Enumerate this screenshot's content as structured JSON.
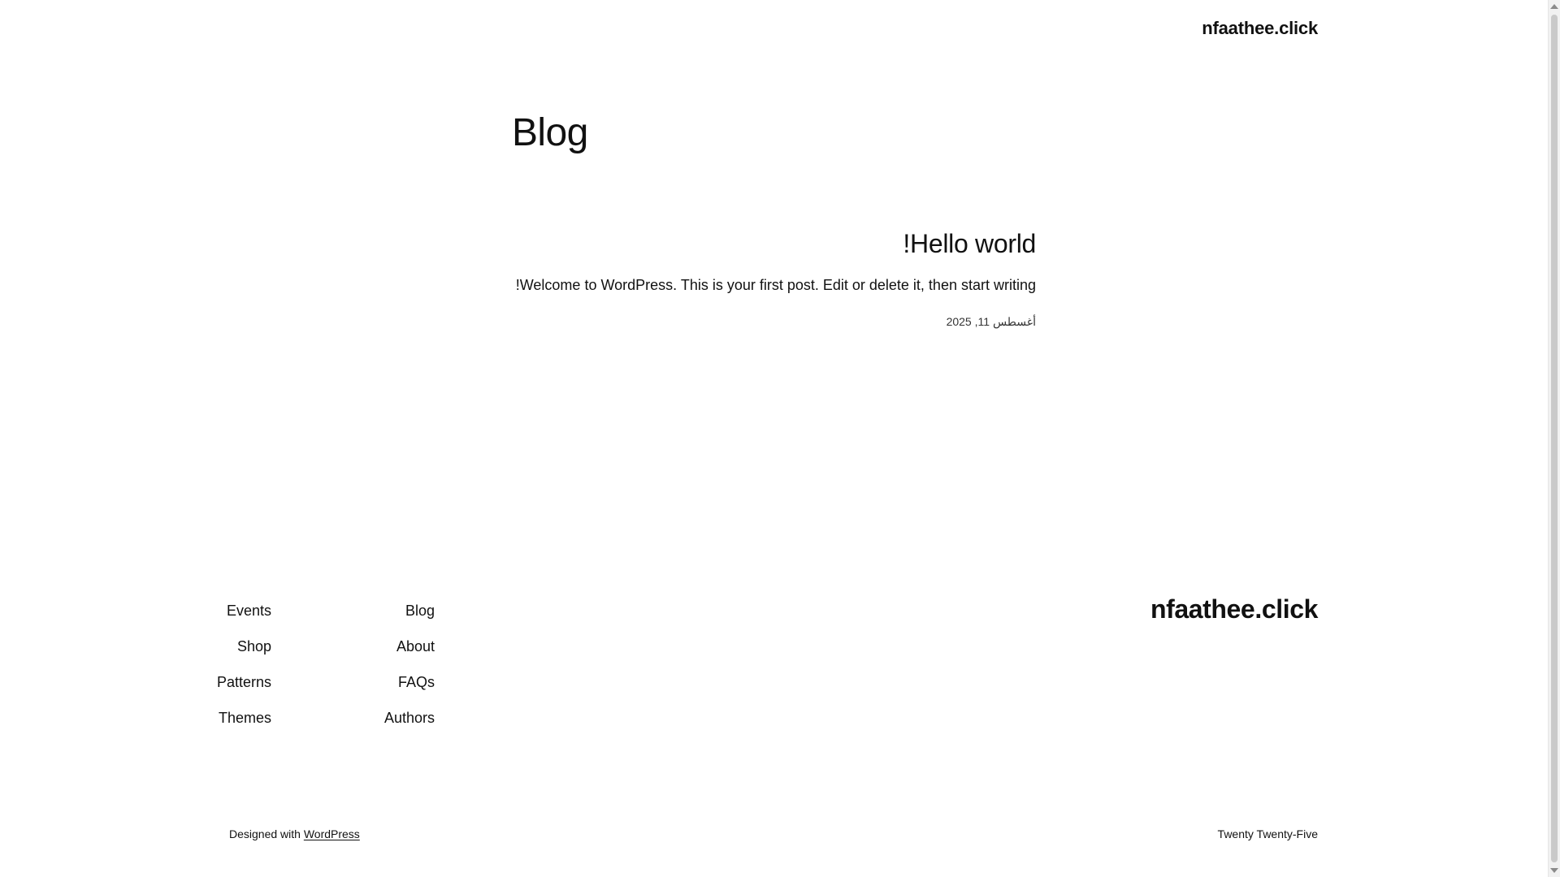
{
  "header": {
    "site_title": "nfaathee.click"
  },
  "main": {
    "page_title": "Blog",
    "posts": [
      {
        "title": "!Hello world",
        "excerpt": "!Welcome to WordPress. This is your first post. Edit or delete it, then start writing",
        "date": "أغسطس 11, 2025"
      }
    ]
  },
  "footer": {
    "nav_left": [
      "Events",
      "Shop",
      "Patterns",
      "Themes"
    ],
    "nav_right": [
      "Blog",
      "About",
      "FAQs",
      "Authors"
    ],
    "site_title": "nfaathee.click",
    "credit_prefix": "Designed with",
    "credit_link": "WordPress",
    "theme_name": "Twenty Twenty-Five"
  }
}
